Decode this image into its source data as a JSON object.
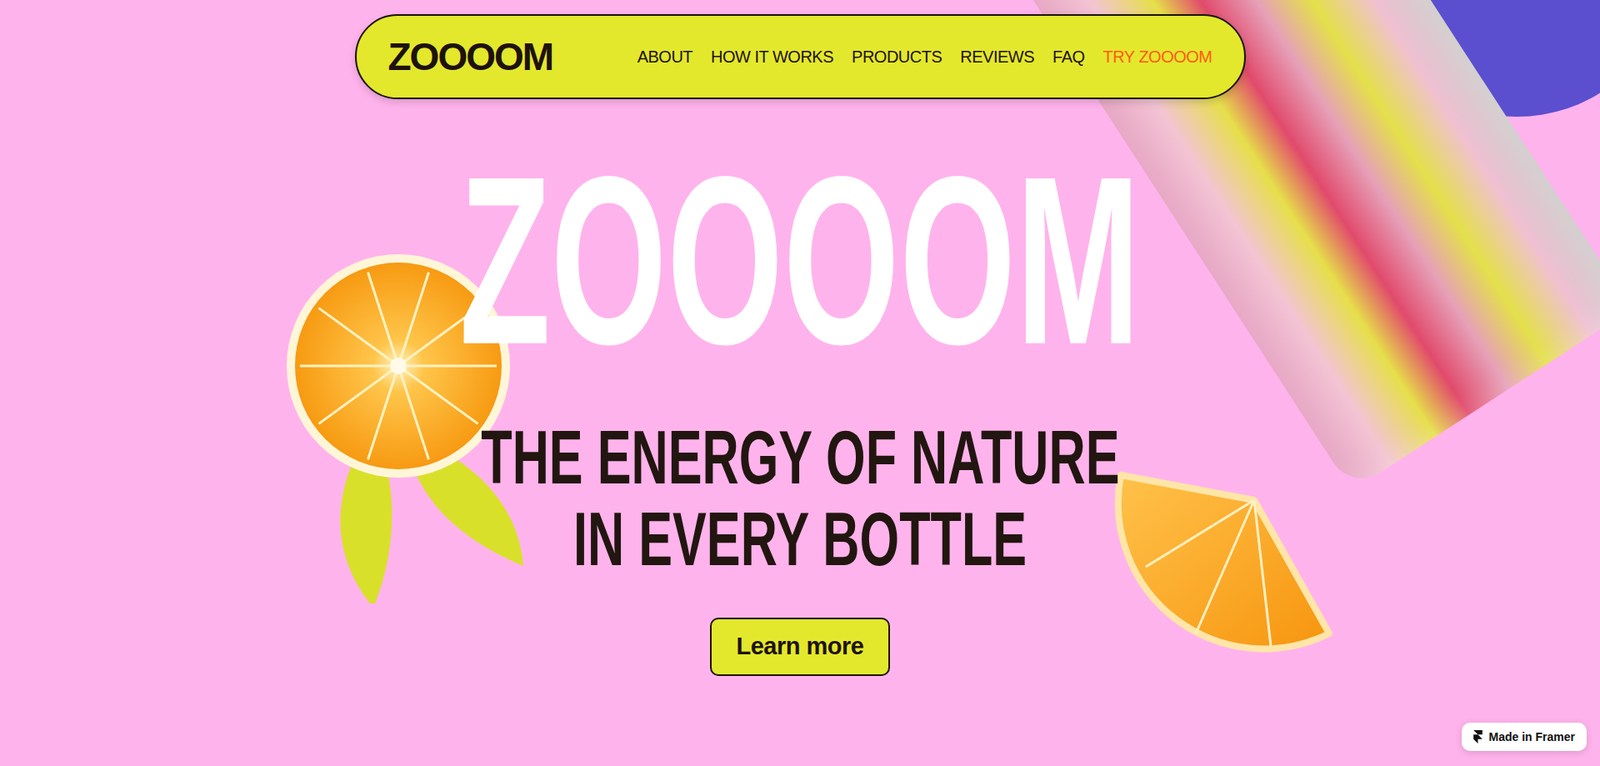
{
  "brand": {
    "logo": "ZOOOOM"
  },
  "nav": {
    "links": [
      {
        "label": "ABOUT",
        "highlighted": false
      },
      {
        "label": "HOW IT WORKS",
        "highlighted": false
      },
      {
        "label": "PRODUCTS",
        "highlighted": false
      },
      {
        "label": "REVIEWS",
        "highlighted": false
      },
      {
        "label": "FAQ",
        "highlighted": false
      },
      {
        "label": "TRY ZOOOOM",
        "highlighted": true
      }
    ]
  },
  "hero": {
    "title": "ZOOOOM",
    "subtitle": [
      "THE ENERGY OF NATURE",
      "IN EVERY BOTTLE"
    ],
    "button": "Learn more"
  },
  "badge": {
    "label": "Made in Framer"
  }
}
